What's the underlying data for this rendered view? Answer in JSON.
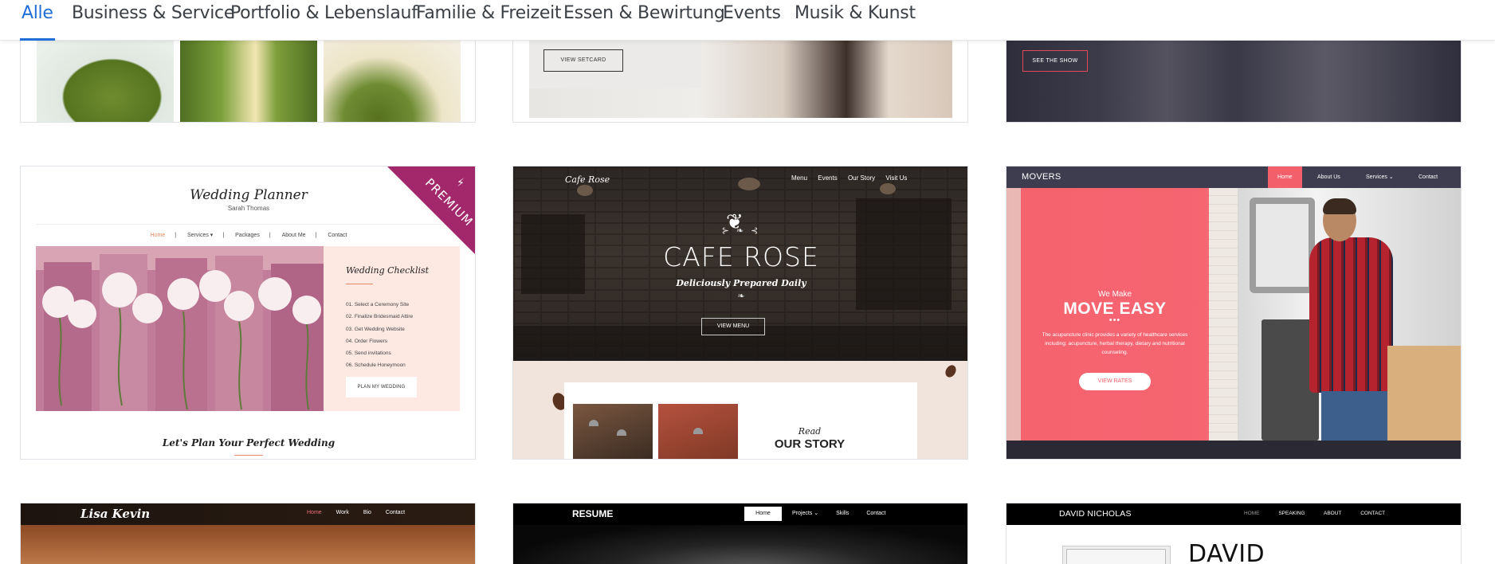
{
  "nav": {
    "tabs": [
      {
        "label": "Alle",
        "active": true
      },
      {
        "label": "Business & Service"
      },
      {
        "label": "Portfolio & Lebenslauf"
      },
      {
        "label": "Familie & Freizeit"
      },
      {
        "label": "Essen & Bewirtung"
      },
      {
        "label": "Events"
      },
      {
        "label": "Musik & Kunst"
      }
    ],
    "active_color": "#1f6fd6"
  },
  "row1": {
    "setcard_button": "VIEW SETCARD",
    "show_button": "SEE THE SHOW"
  },
  "wedding": {
    "title": "Wedding Planner",
    "subtitle": "Sarah Thomas",
    "nav": [
      "Home",
      "Services ▾",
      "Packages",
      "About Me",
      "Contact"
    ],
    "badge": "PREMIUM",
    "checklist_title": "Wedding Checklist",
    "checklist": [
      "01. Select a Ceremony Site",
      "02. Finalize Bridesmaid Attire",
      "03. Get Wedding Website",
      "04. Order Flowers",
      "05. Send invitations",
      "06. Schedule Honeymoon"
    ],
    "button": "PLAN MY WEDDING",
    "tagline": "Let's Plan Your Perfect Wedding",
    "badge_color": "#a3276b"
  },
  "cafe": {
    "logo": "Cafe Rose",
    "nav": [
      "Menu",
      "Events",
      "Our Story",
      "Visit Us"
    ],
    "title": "CAFE ROSE",
    "subtitle": "Deliciously Prepared Daily",
    "button": "VIEW MENU",
    "read": "Read",
    "story": "OUR STORY"
  },
  "movers": {
    "brand": "MOVERS",
    "nav": [
      "Home",
      "About Us",
      "Services ⌄",
      "Contact"
    ],
    "kicker": "We Make",
    "title": "MOVE EASY",
    "dots": "•••",
    "description": "The acupuncture clinic provides a variety of healthcare services including: acupuncture, herbal therapy, dietary and nutritional counseling.",
    "button": "VIEW RATES",
    "accent": "#f35f6a"
  },
  "lisa": {
    "name": "Lisa Kevin",
    "nav": [
      "Home",
      "Work",
      "Bio",
      "Contact"
    ]
  },
  "resume": {
    "name": "RESUME",
    "home": "Home",
    "nav": [
      "Projects ⌄",
      "Skills",
      "Contact"
    ]
  },
  "david": {
    "name": "DAVID NICHOLAS",
    "nav": [
      "HOME",
      "SPEAKING",
      "ABOUT",
      "CONTACT"
    ],
    "big": "DAVID"
  }
}
